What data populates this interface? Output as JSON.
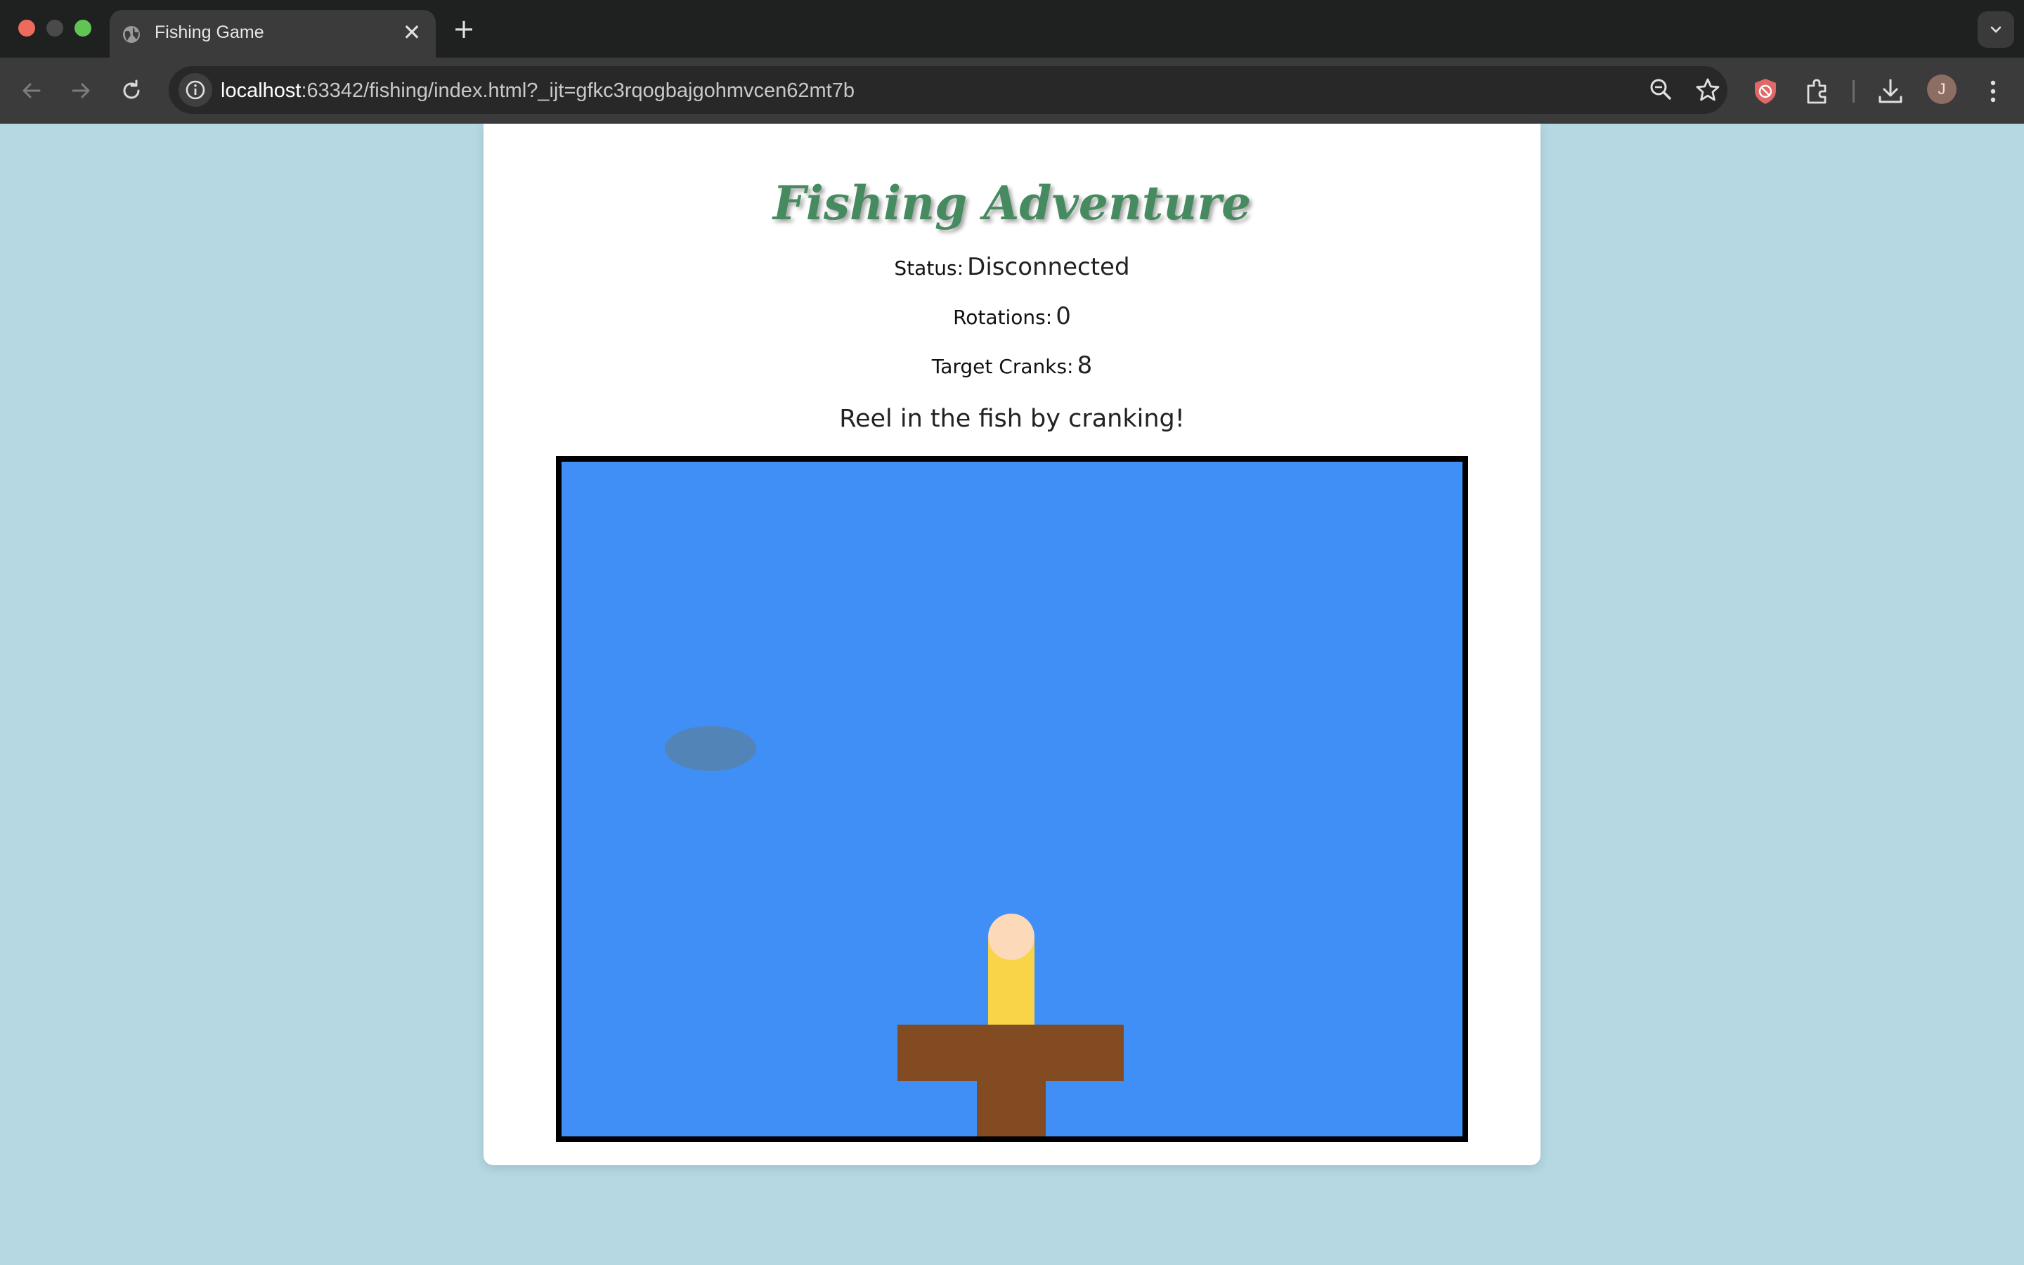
{
  "browser": {
    "tab_title": "Fishing Game",
    "new_tab": "+",
    "close_tab": "✕",
    "url_host": "localhost",
    "url_rest": ":63342/fishing/index.html?_ijt=gfkc3rqogbajgohmvcen62mt7b",
    "profile_initial": "J",
    "icons": [
      "back-icon",
      "forward-icon",
      "reload-icon",
      "site-info-icon",
      "zoom-icon",
      "bookmark-star-icon",
      "shield-extension-icon",
      "extensions-icon",
      "download-icon",
      "kebab-menu-icon"
    ]
  },
  "page": {
    "title": "Fishing Adventure",
    "status_label": "Status:",
    "status_value": "Disconnected",
    "rotations_label": "Rotations:",
    "rotations_value": "0",
    "target_label": "Target Cranks:",
    "target_value": "8",
    "instructions": "Reel in the fish by cranking!"
  },
  "colors": {
    "page_background": "#b5d8e3",
    "title_green": "#458b5f",
    "water": "#3f8ff7",
    "fish_shadow": "#5384b8",
    "crank_arm": "#f9d448",
    "crank_knob": "#fbd9b9",
    "dock_wood": "#824b22"
  }
}
